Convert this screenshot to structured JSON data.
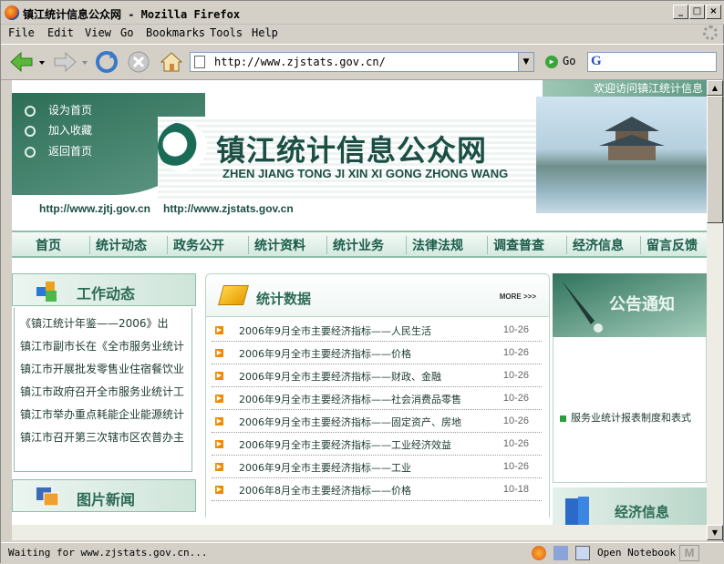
{
  "window": {
    "title": "镇江统计信息公众网 - Mozilla Firefox"
  },
  "menu": [
    "File",
    "Edit",
    "View",
    "Go",
    "Bookmarks",
    "Tools",
    "Help"
  ],
  "toolbar": {
    "url": "http://www.zjstats.gov.cn/",
    "go_label": "Go",
    "search_logo": "G"
  },
  "banner": {
    "welcome": "欢迎访问镇江统计信息",
    "quick_links": [
      "设为首页",
      "加入收藏",
      "返回首页"
    ],
    "site_title": "镇江统计信息公众网",
    "pinyin": "ZHEN JIANG TONG JI XIN XI GONG ZHONG WANG",
    "urls": [
      "http://www.zjtj.gov.cn",
      "http://www.zjstats.gov.cn"
    ]
  },
  "nav": [
    "首页",
    "统计动态",
    "政务公开",
    "统计资料",
    "统计业务",
    "法律法规",
    "调查普查",
    "经济信息",
    "留言反馈"
  ],
  "left": {
    "work_title": "工作动态",
    "news": [
      "《镇江统计年鉴——2006》出",
      "镇江市副市长在《全市服务业统计",
      "镇江市开展批发零售业住宿餐饮业",
      "镇江市政府召开全市服务业统计工",
      "镇江市举办重点耗能企业能源统计",
      "镇江市召开第三次辖市区农普办主"
    ],
    "photo_title": "图片新闻"
  },
  "center": {
    "title": "统计数据",
    "more": "MORE >>>",
    "items": [
      {
        "title": "2006年9月全市主要经济指标——人民生活",
        "date": "10-26"
      },
      {
        "title": "2006年9月全市主要经济指标——价格",
        "date": "10-26"
      },
      {
        "title": "2006年9月全市主要经济指标——财政、金融",
        "date": "10-26"
      },
      {
        "title": "2006年9月全市主要经济指标——社会消费品零售",
        "date": "10-26"
      },
      {
        "title": "2006年9月全市主要经济指标——固定资产、房地",
        "date": "10-26"
      },
      {
        "title": "2006年9月全市主要经济指标——工业经济效益",
        "date": "10-26"
      },
      {
        "title": "2006年9月全市主要经济指标——工业",
        "date": "10-26"
      },
      {
        "title": "2006年8月全市主要经济指标——价格",
        "date": "10-18"
      }
    ]
  },
  "right": {
    "notice_title": "公告通知",
    "notice_item": "服务业统计报表制度和表式",
    "econ_title": "经济信息"
  },
  "status": {
    "text": "Waiting for www.zjstats.gov.cn...",
    "notebook": "Open Notebook"
  }
}
